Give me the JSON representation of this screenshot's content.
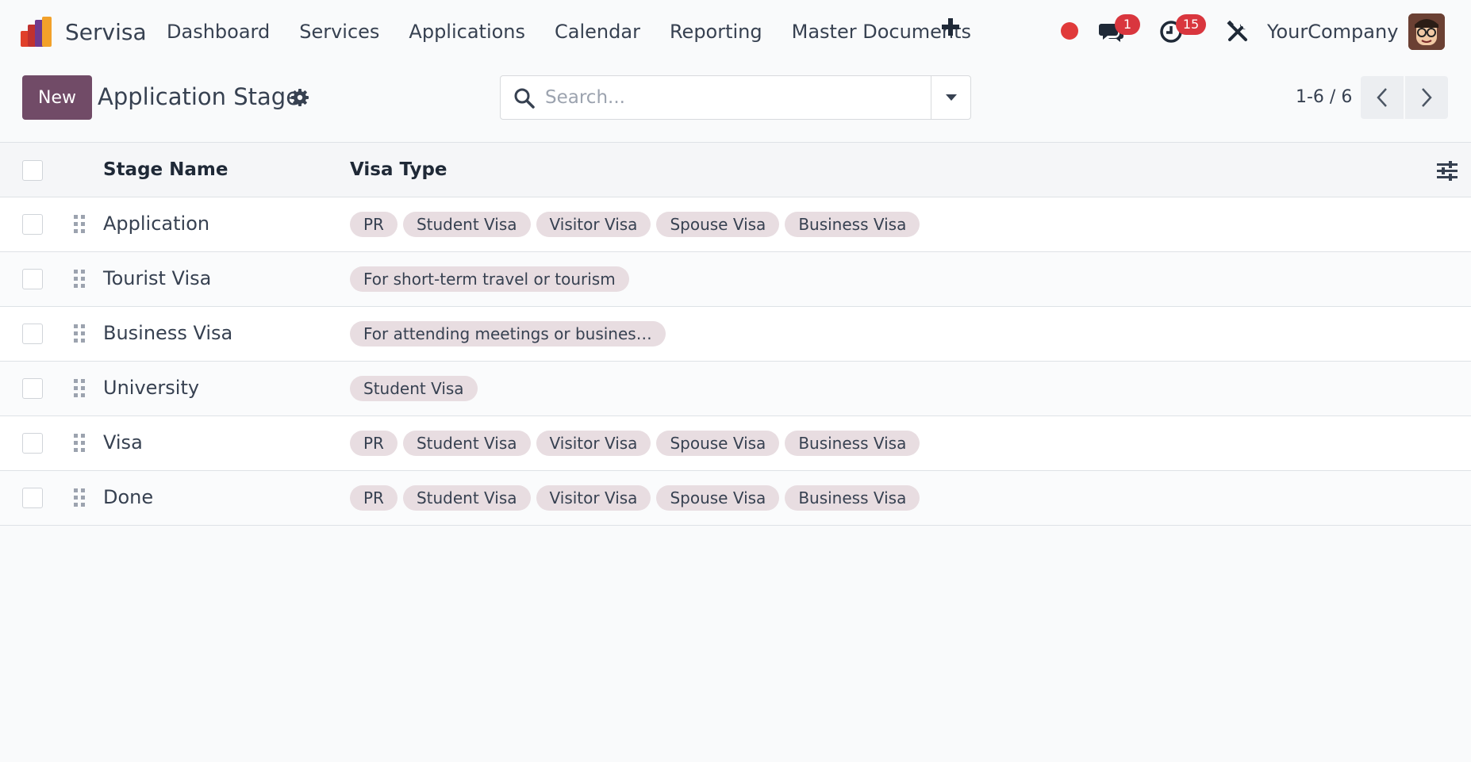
{
  "navbar": {
    "app_name": "Servisa",
    "menu": [
      "Dashboard",
      "Services",
      "Applications",
      "Calendar",
      "Reporting",
      "Master Documents"
    ],
    "plus_icon": "plus-icon",
    "messages_badge": "1",
    "activities_badge": "15",
    "company": "YourCompany",
    "status_dot_color": "#e03a3a",
    "badge_color": "#d9363e"
  },
  "control": {
    "new_label": "New",
    "title": "Application Stage",
    "search_placeholder": "Search...",
    "pager": "1-6 / 6",
    "accent_color": "#714b67"
  },
  "table": {
    "headers": {
      "stage": "Stage Name",
      "visa": "Visa Type"
    },
    "rows": [
      {
        "stage": "Application",
        "visa": [
          "PR",
          "Student Visa",
          "Visitor Visa",
          "Spouse Visa",
          "Business Visa"
        ]
      },
      {
        "stage": "Tourist Visa",
        "visa": [
          "For short-term travel or tourism"
        ]
      },
      {
        "stage": "Business Visa",
        "visa": [
          "For attending meetings or busines…"
        ]
      },
      {
        "stage": "University",
        "visa": [
          "Student Visa"
        ]
      },
      {
        "stage": "Visa",
        "visa": [
          "PR",
          "Student Visa",
          "Visitor Visa",
          "Spouse Visa",
          "Business Visa"
        ]
      },
      {
        "stage": "Done",
        "visa": [
          "PR",
          "Student Visa",
          "Visitor Visa",
          "Spouse Visa",
          "Business Visa"
        ]
      }
    ]
  }
}
